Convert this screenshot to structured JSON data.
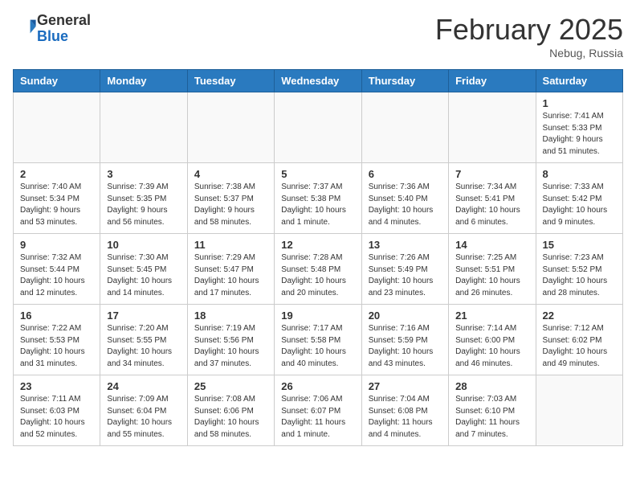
{
  "header": {
    "logo_general": "General",
    "logo_blue": "Blue",
    "month_year": "February 2025",
    "location": "Nebug, Russia"
  },
  "weekdays": [
    "Sunday",
    "Monday",
    "Tuesday",
    "Wednesday",
    "Thursday",
    "Friday",
    "Saturday"
  ],
  "weeks": [
    [
      {
        "day": "",
        "info": ""
      },
      {
        "day": "",
        "info": ""
      },
      {
        "day": "",
        "info": ""
      },
      {
        "day": "",
        "info": ""
      },
      {
        "day": "",
        "info": ""
      },
      {
        "day": "",
        "info": ""
      },
      {
        "day": "1",
        "info": "Sunrise: 7:41 AM\nSunset: 5:33 PM\nDaylight: 9 hours and 51 minutes."
      }
    ],
    [
      {
        "day": "2",
        "info": "Sunrise: 7:40 AM\nSunset: 5:34 PM\nDaylight: 9 hours and 53 minutes."
      },
      {
        "day": "3",
        "info": "Sunrise: 7:39 AM\nSunset: 5:35 PM\nDaylight: 9 hours and 56 minutes."
      },
      {
        "day": "4",
        "info": "Sunrise: 7:38 AM\nSunset: 5:37 PM\nDaylight: 9 hours and 58 minutes."
      },
      {
        "day": "5",
        "info": "Sunrise: 7:37 AM\nSunset: 5:38 PM\nDaylight: 10 hours and 1 minute."
      },
      {
        "day": "6",
        "info": "Sunrise: 7:36 AM\nSunset: 5:40 PM\nDaylight: 10 hours and 4 minutes."
      },
      {
        "day": "7",
        "info": "Sunrise: 7:34 AM\nSunset: 5:41 PM\nDaylight: 10 hours and 6 minutes."
      },
      {
        "day": "8",
        "info": "Sunrise: 7:33 AM\nSunset: 5:42 PM\nDaylight: 10 hours and 9 minutes."
      }
    ],
    [
      {
        "day": "9",
        "info": "Sunrise: 7:32 AM\nSunset: 5:44 PM\nDaylight: 10 hours and 12 minutes."
      },
      {
        "day": "10",
        "info": "Sunrise: 7:30 AM\nSunset: 5:45 PM\nDaylight: 10 hours and 14 minutes."
      },
      {
        "day": "11",
        "info": "Sunrise: 7:29 AM\nSunset: 5:47 PM\nDaylight: 10 hours and 17 minutes."
      },
      {
        "day": "12",
        "info": "Sunrise: 7:28 AM\nSunset: 5:48 PM\nDaylight: 10 hours and 20 minutes."
      },
      {
        "day": "13",
        "info": "Sunrise: 7:26 AM\nSunset: 5:49 PM\nDaylight: 10 hours and 23 minutes."
      },
      {
        "day": "14",
        "info": "Sunrise: 7:25 AM\nSunset: 5:51 PM\nDaylight: 10 hours and 26 minutes."
      },
      {
        "day": "15",
        "info": "Sunrise: 7:23 AM\nSunset: 5:52 PM\nDaylight: 10 hours and 28 minutes."
      }
    ],
    [
      {
        "day": "16",
        "info": "Sunrise: 7:22 AM\nSunset: 5:53 PM\nDaylight: 10 hours and 31 minutes."
      },
      {
        "day": "17",
        "info": "Sunrise: 7:20 AM\nSunset: 5:55 PM\nDaylight: 10 hours and 34 minutes."
      },
      {
        "day": "18",
        "info": "Sunrise: 7:19 AM\nSunset: 5:56 PM\nDaylight: 10 hours and 37 minutes."
      },
      {
        "day": "19",
        "info": "Sunrise: 7:17 AM\nSunset: 5:58 PM\nDaylight: 10 hours and 40 minutes."
      },
      {
        "day": "20",
        "info": "Sunrise: 7:16 AM\nSunset: 5:59 PM\nDaylight: 10 hours and 43 minutes."
      },
      {
        "day": "21",
        "info": "Sunrise: 7:14 AM\nSunset: 6:00 PM\nDaylight: 10 hours and 46 minutes."
      },
      {
        "day": "22",
        "info": "Sunrise: 7:12 AM\nSunset: 6:02 PM\nDaylight: 10 hours and 49 minutes."
      }
    ],
    [
      {
        "day": "23",
        "info": "Sunrise: 7:11 AM\nSunset: 6:03 PM\nDaylight: 10 hours and 52 minutes."
      },
      {
        "day": "24",
        "info": "Sunrise: 7:09 AM\nSunset: 6:04 PM\nDaylight: 10 hours and 55 minutes."
      },
      {
        "day": "25",
        "info": "Sunrise: 7:08 AM\nSunset: 6:06 PM\nDaylight: 10 hours and 58 minutes."
      },
      {
        "day": "26",
        "info": "Sunrise: 7:06 AM\nSunset: 6:07 PM\nDaylight: 11 hours and 1 minute."
      },
      {
        "day": "27",
        "info": "Sunrise: 7:04 AM\nSunset: 6:08 PM\nDaylight: 11 hours and 4 minutes."
      },
      {
        "day": "28",
        "info": "Sunrise: 7:03 AM\nSunset: 6:10 PM\nDaylight: 11 hours and 7 minutes."
      },
      {
        "day": "",
        "info": ""
      }
    ]
  ]
}
